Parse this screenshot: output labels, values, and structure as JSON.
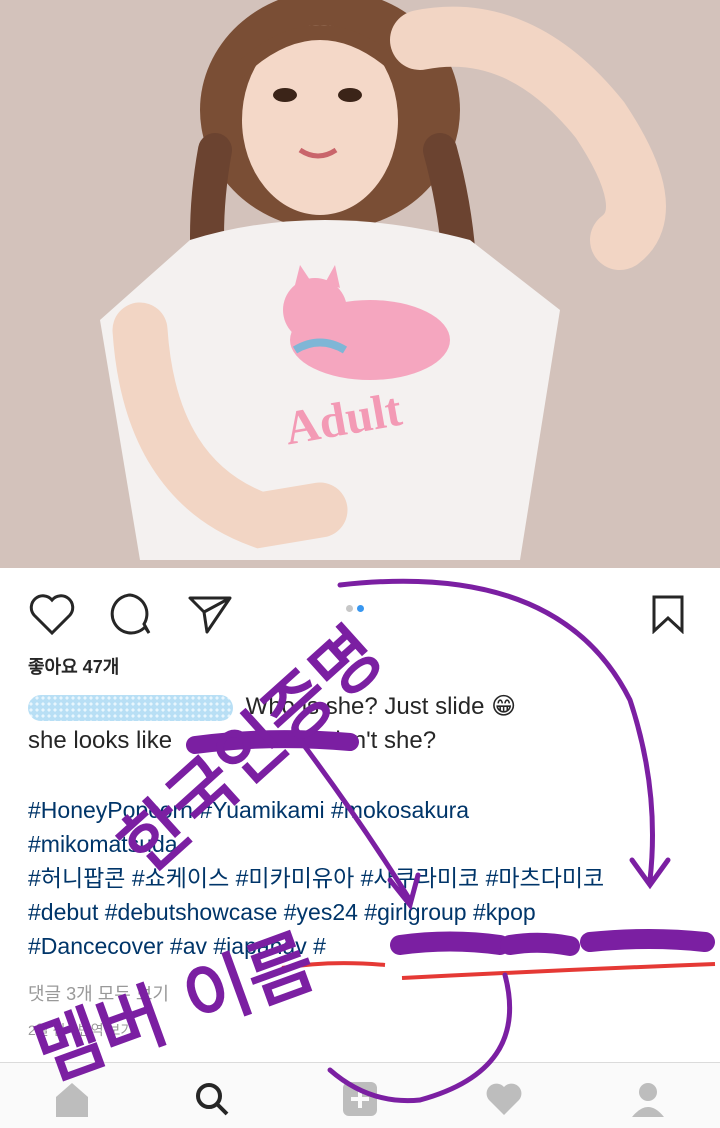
{
  "post": {
    "image_shirt_text": "Adult",
    "likes_label": "좋아요 47개",
    "caption_line1": "Who is she? Just slide 😁",
    "caption_line2_a": "she looks like",
    "caption_line2_b": "isn't she?",
    "hashtags_line1": "#HoneyPopcorn #Yuamikami #mokosakura",
    "hashtags_line2": "#mikomatsuda",
    "hashtags_line3": "#허니팝콘 #쇼케이스 #미카미유아 #사쿠라미코 #마츠다미코",
    "hashtags_line4": "#debut #debutshowcase #yes24 #girlgroup #kpop",
    "hashtags_line5": "#Dancecover #av #japanav #",
    "comments_label": "댓글 3개 모두 보기",
    "time_label": "2일 전 · 번역 보기"
  },
  "annotations": {
    "handwriting_left": "한국인증명",
    "handwriting_bottom": "멤버 이름",
    "scribble_color": "#7b1fa2",
    "underline_color": "#e53935"
  },
  "icons": {
    "like": "heart-icon",
    "comment": "comment-icon",
    "share": "send-icon",
    "save": "bookmark-icon",
    "nav": [
      "home-icon",
      "search-icon",
      "add-icon",
      "activity-heart-icon",
      "profile-icon"
    ]
  }
}
